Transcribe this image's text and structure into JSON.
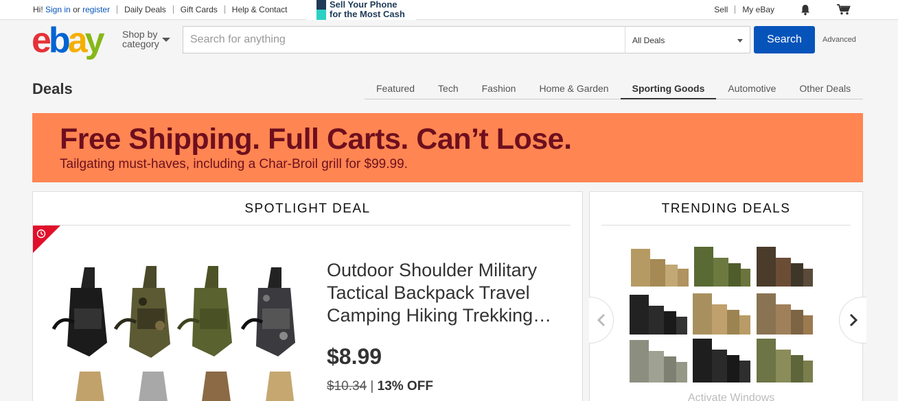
{
  "topbar": {
    "greeting": "Hi!",
    "sign_in": "Sign in",
    "or": "or",
    "register": "register",
    "links": [
      "Daily Deals",
      "Gift Cards",
      "Help & Contact"
    ],
    "promo_line1": "Sell Your Phone",
    "promo_line2": "for the Most Cash",
    "sell": "Sell",
    "my_ebay": "My eBay",
    "icons": [
      "bell-icon",
      "cart-icon"
    ]
  },
  "header": {
    "logo": "ebay",
    "shop_by": "Shop by",
    "category": "category",
    "search_placeholder": "Search for anything",
    "category_select": "All Deals",
    "search_button": "Search",
    "advanced": "Advanced"
  },
  "deals": {
    "title": "Deals",
    "tabs": [
      {
        "label": "Featured",
        "active": false
      },
      {
        "label": "Tech",
        "active": false
      },
      {
        "label": "Fashion",
        "active": false
      },
      {
        "label": "Home & Garden",
        "active": false
      },
      {
        "label": "Sporting Goods",
        "active": true
      },
      {
        "label": "Automotive",
        "active": false
      },
      {
        "label": "Other Deals",
        "active": false
      }
    ]
  },
  "banner": {
    "headline": "Free Shipping. Full Carts. Can’t Lose.",
    "subline": "Tailgating must-haves, including a Char-Broil grill for $99.99.",
    "bg_color": "#ff8552",
    "text_color": "#6e0f1e"
  },
  "spotlight": {
    "heading": "SPOTLIGHT DEAL",
    "product_title": "Outdoor Shoulder Military Tactical Backpack Travel Camping Hiking Trekking…",
    "price": "$8.99",
    "original_price": "$10.34",
    "separator": "|",
    "discount": "13% OFF"
  },
  "trending": {
    "heading": "TRENDING DEALS"
  },
  "os_watermark": "Activate Windows",
  "colors": {
    "accent": "#0654ba",
    "timer": "#e0102b"
  }
}
